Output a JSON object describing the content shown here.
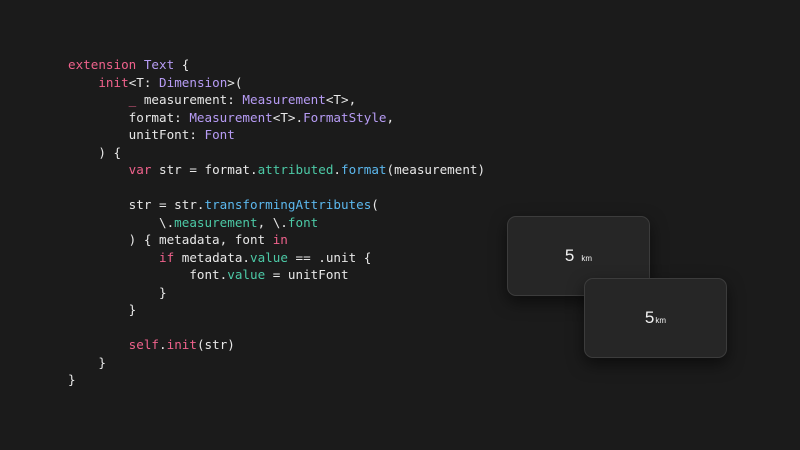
{
  "code": {
    "lines": [
      [
        {
          "t": "extension ",
          "c": "kw"
        },
        {
          "t": "Text",
          "c": "ty"
        },
        {
          "t": " {",
          "c": "tx"
        }
      ],
      [
        {
          "t": "    ",
          "c": "tx"
        },
        {
          "t": "init",
          "c": "kw"
        },
        {
          "t": "<T: ",
          "c": "tx"
        },
        {
          "t": "Dimension",
          "c": "ty"
        },
        {
          "t": ">(",
          "c": "tx"
        }
      ],
      [
        {
          "t": "        ",
          "c": "tx"
        },
        {
          "t": "_",
          "c": "kw"
        },
        {
          "t": " measurement: ",
          "c": "tx"
        },
        {
          "t": "Measurement",
          "c": "ty"
        },
        {
          "t": "<T>,",
          "c": "tx"
        }
      ],
      [
        {
          "t": "        format: ",
          "c": "tx"
        },
        {
          "t": "Measurement",
          "c": "ty"
        },
        {
          "t": "<T>.",
          "c": "tx"
        },
        {
          "t": "FormatStyle",
          "c": "ty"
        },
        {
          "t": ",",
          "c": "tx"
        }
      ],
      [
        {
          "t": "        unitFont: ",
          "c": "tx"
        },
        {
          "t": "Font",
          "c": "ty"
        }
      ],
      [
        {
          "t": "    ) {",
          "c": "tx"
        }
      ],
      [
        {
          "t": "        ",
          "c": "tx"
        },
        {
          "t": "var",
          "c": "kw"
        },
        {
          "t": " str = format.",
          "c": "tx"
        },
        {
          "t": "attributed",
          "c": "pr"
        },
        {
          "t": ".",
          "c": "tx"
        },
        {
          "t": "format",
          "c": "fn"
        },
        {
          "t": "(measurement)",
          "c": "tx"
        }
      ],
      [],
      [
        {
          "t": "        str = str.",
          "c": "tx"
        },
        {
          "t": "transformingAttributes",
          "c": "fn"
        },
        {
          "t": "(",
          "c": "tx"
        }
      ],
      [
        {
          "t": "            \\.",
          "c": "tx"
        },
        {
          "t": "measurement",
          "c": "pr"
        },
        {
          "t": ", \\.",
          "c": "tx"
        },
        {
          "t": "font",
          "c": "pr"
        }
      ],
      [
        {
          "t": "        ) { metadata, font ",
          "c": "tx"
        },
        {
          "t": "in",
          "c": "kw"
        }
      ],
      [
        {
          "t": "            ",
          "c": "tx"
        },
        {
          "t": "if",
          "c": "kw"
        },
        {
          "t": " metadata.",
          "c": "tx"
        },
        {
          "t": "value",
          "c": "pr"
        },
        {
          "t": " == .unit {",
          "c": "tx"
        }
      ],
      [
        {
          "t": "                font.",
          "c": "tx"
        },
        {
          "t": "value",
          "c": "pr"
        },
        {
          "t": " = unitFont",
          "c": "tx"
        }
      ],
      [
        {
          "t": "            }",
          "c": "tx"
        }
      ],
      [
        {
          "t": "        }",
          "c": "tx"
        }
      ],
      [],
      [
        {
          "t": "        ",
          "c": "tx"
        },
        {
          "t": "self",
          "c": "kw"
        },
        {
          "t": ".",
          "c": "tx"
        },
        {
          "t": "init",
          "c": "kw"
        },
        {
          "t": "(str)",
          "c": "tx"
        }
      ],
      [
        {
          "t": "    }",
          "c": "tx"
        }
      ],
      [
        {
          "t": "}",
          "c": "tx"
        }
      ]
    ]
  },
  "previews": [
    {
      "number": "5",
      "unit": "km"
    },
    {
      "number": "5",
      "unit": "km"
    }
  ],
  "colors": {
    "background": "#1b1b1b",
    "keyword": "#f0628c",
    "type": "#b79cf5",
    "function": "#5cb8ee",
    "property": "#4cc9a6",
    "plain": "#e8e8e8",
    "card": "#262626"
  }
}
